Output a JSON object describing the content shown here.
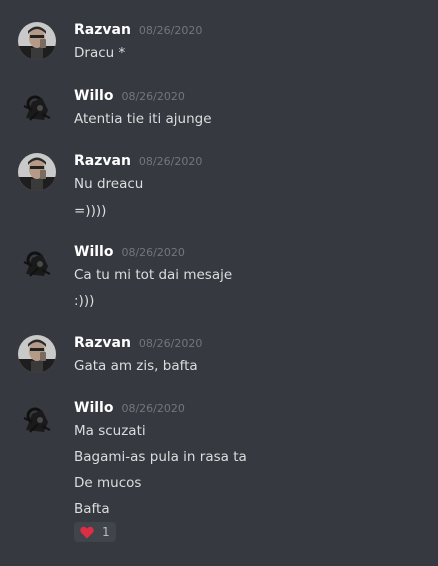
{
  "messages": [
    {
      "username": "Razvan",
      "timestamp": "08/26/2020",
      "avatar": "razvan-avatar",
      "lines": [
        "Dracu *"
      ]
    },
    {
      "username": "Willo",
      "timestamp": "08/26/2020",
      "avatar": "willo-avatar",
      "lines": [
        "Atentia tie iti ajunge"
      ]
    },
    {
      "username": "Razvan",
      "timestamp": "08/26/2020",
      "avatar": "razvan-avatar",
      "lines": [
        "Nu dreacu",
        "=))))"
      ]
    },
    {
      "username": "Willo",
      "timestamp": "08/26/2020",
      "avatar": "willo-avatar",
      "lines": [
        "Ca tu mi tot dai mesaje",
        ":)))"
      ]
    },
    {
      "username": "Razvan",
      "timestamp": "08/26/2020",
      "avatar": "razvan-avatar",
      "lines": [
        "Gata am zis, bafta"
      ]
    },
    {
      "username": "Willo",
      "timestamp": "08/26/2020",
      "avatar": "willo-avatar",
      "lines": [
        "Ma scuzati",
        "Bagami-as pula in rasa ta",
        "De mucos",
        "Bafta"
      ],
      "reaction": {
        "emoji": "heart-icon",
        "count": "1"
      }
    }
  ],
  "colors": {
    "background": "#36393f",
    "username": "#ffffff",
    "timestamp": "#72767d",
    "message_text": "#dcddde",
    "reaction_bg": "#40444b",
    "heart": "#dd2e44"
  }
}
